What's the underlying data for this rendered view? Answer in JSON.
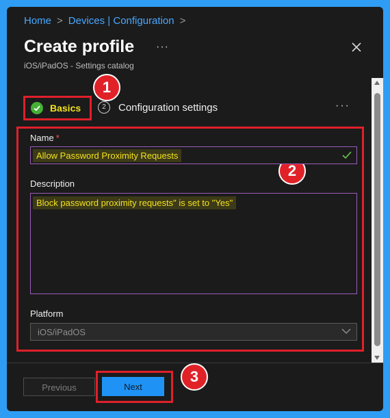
{
  "breadcrumb": {
    "home": "Home",
    "devices": "Devices | Configuration"
  },
  "header": {
    "title": "Create profile",
    "subtitle": "iOS/iPadOS - Settings catalog"
  },
  "tabs": {
    "basics": "Basics",
    "config_step": "2",
    "config": "Configuration settings"
  },
  "form": {
    "name_label": "Name",
    "required_mark": "*",
    "name_value": "Allow Password Proximity Requests",
    "description_label": "Description",
    "description_value": "Block password proximity requests\" is set to \"Yes\"",
    "platform_label": "Platform",
    "platform_value": "iOS/iPadOS"
  },
  "footer": {
    "previous": "Previous",
    "next": "Next"
  },
  "annotations": {
    "one": "1",
    "two": "2",
    "three": "3"
  },
  "colors": {
    "accent": "#1f93f5",
    "highlight_border": "#e0202a",
    "success": "#45b035",
    "link": "#4aa8ff"
  },
  "icons": [
    "chevron-right-icon",
    "close-icon",
    "check-circle-icon",
    "checkmark-icon",
    "chevron-down-icon",
    "more-icon"
  ]
}
